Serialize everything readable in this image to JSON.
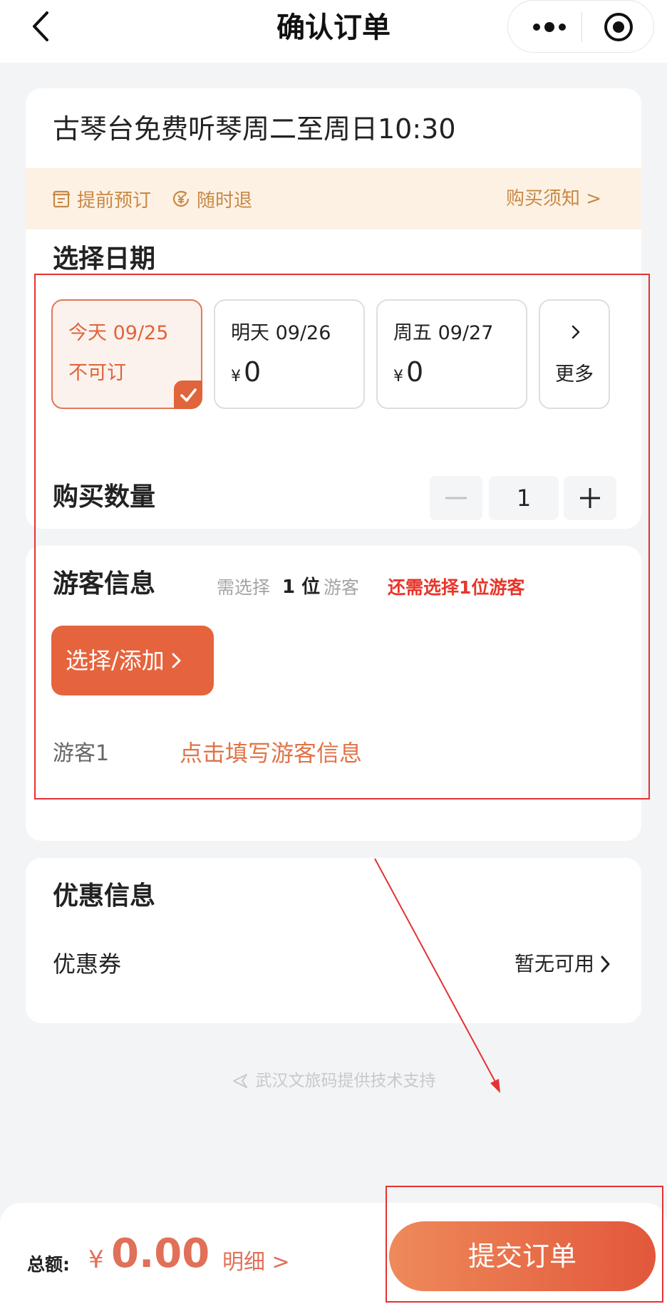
{
  "nav": {
    "title": "确认订单"
  },
  "product": {
    "title": "古琴台免费听琴周二至周日10:30",
    "tags": [
      "提前预订",
      "随时退"
    ],
    "notice_link": "购买须知 >"
  },
  "date_section": {
    "label": "选择日期",
    "dates": [
      {
        "date": "今天 09/25",
        "status": "不可订",
        "selected": true
      },
      {
        "date": "明天 09/26",
        "currency": "¥",
        "price": "0"
      },
      {
        "date": "周五 09/27",
        "currency": "¥",
        "price": "0"
      }
    ],
    "more_label": "更多"
  },
  "quantity": {
    "label": "购买数量",
    "value": "1"
  },
  "tourist": {
    "label": "游客信息",
    "hint_prefix": "需选择",
    "count": "1 位",
    "hint_suffix": "游客",
    "warning": "还需选择1位游客",
    "select_button": "选择/添加",
    "row_label": "游客1",
    "row_link": "点击填写游客信息"
  },
  "discount": {
    "label": "优惠信息",
    "coupon_label": "优惠券",
    "coupon_value": "暂无可用"
  },
  "support_text": "武汉文旅码提供技术支持",
  "footer": {
    "total_label": "总额:",
    "currency": "¥",
    "total_amount": "0.00",
    "detail_link": "明细 >",
    "submit_button": "提交订单"
  },
  "colors": {
    "accent": "#e5643d",
    "tag_text": "#c88844",
    "tag_bg": "#fdf1e4",
    "warning": "#e8352a",
    "annotation": "#e53232"
  },
  "icons": {
    "back": "chevron-left-icon",
    "menu": "more-dots-icon",
    "target": "target-icon",
    "advance_booking": "receipt-icon",
    "refund": "yen-circle-icon",
    "selected": "check-icon",
    "support": "send-icon"
  }
}
